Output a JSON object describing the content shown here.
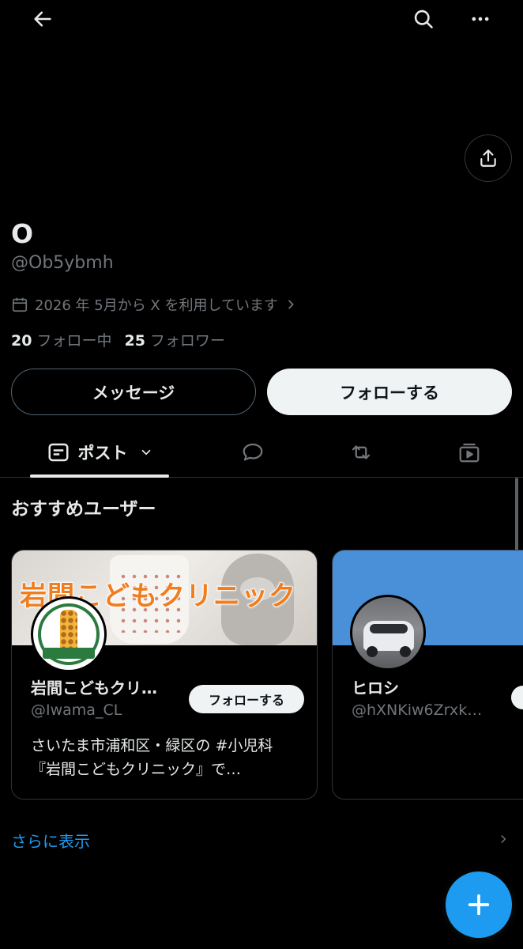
{
  "header": {
    "back_icon": "arrow-left-icon",
    "search_icon": "search-icon",
    "more_icon": "more-horizontal-icon",
    "share_icon": "share-icon"
  },
  "profile": {
    "display_name": "O",
    "handle": "@Ob5ybmh",
    "joined": "2026 年 5月から X を利用しています",
    "following_count": "20",
    "following_label": "フォロー中",
    "followers_count": "25",
    "followers_label": "フォロワー"
  },
  "actions": {
    "message_label": "メッセージ",
    "follow_label": "フォローする"
  },
  "tabs": {
    "posts_label": "ポスト",
    "posts_icon": "posts-icon",
    "replies_icon": "speech-bubble-icon",
    "reposts_icon": "repost-icon",
    "media_icon": "media-icon"
  },
  "recommended": {
    "title": "おすすめユーザー",
    "cards": [
      {
        "banner_text": "岩間こどもクリニック",
        "name": "岩間こどもクリ…",
        "handle": "@Iwama_CL",
        "follow_label": "フォローする",
        "bio": "さいたま市浦和区・緑区の #小児科『岩間こどもクリニック』で…"
      },
      {
        "name": "ヒロシ",
        "handle": "@hXNKiw6Zrxk…"
      }
    ],
    "show_more": "さらに表示"
  },
  "colors": {
    "background": "#000000",
    "accent": "#1d9bf0",
    "text_primary": "#e7e9ea",
    "text_secondary": "#71767b"
  }
}
